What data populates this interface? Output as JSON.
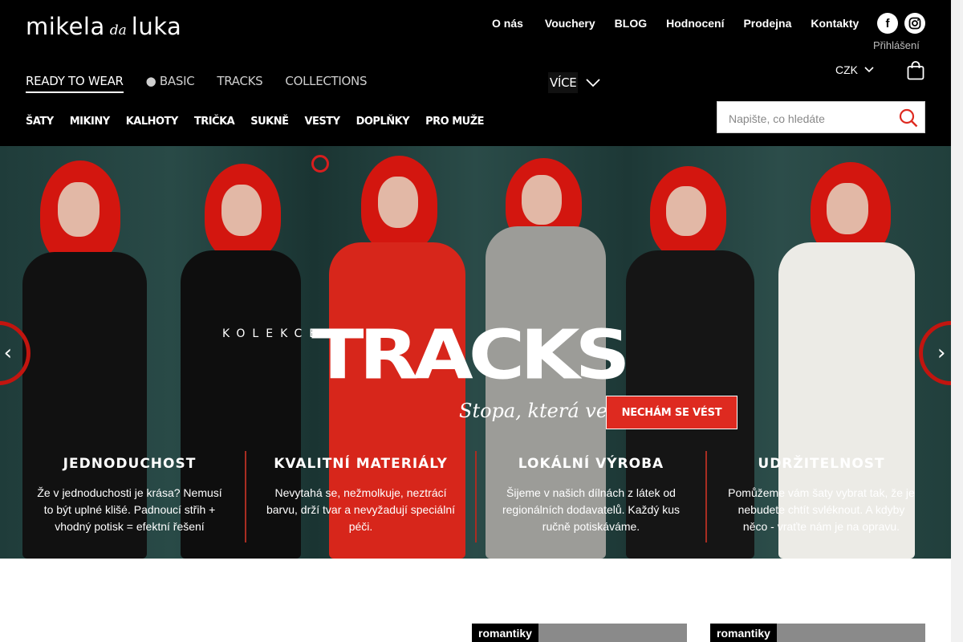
{
  "brand": {
    "name_a": "mikela",
    "name_b": "da",
    "name_c": "luka"
  },
  "topnav": [
    {
      "label": "O nás"
    },
    {
      "label": "Vouchery",
      "icon": ""
    },
    {
      "label": "BLOG"
    },
    {
      "label": "Hodnocení"
    },
    {
      "label": "Prodejna"
    },
    {
      "label": "Kontakty"
    }
  ],
  "social": {
    "facebook": "f",
    "instagram": "instagram-icon"
  },
  "account": {
    "login": "Přihlášení"
  },
  "currency": {
    "value": "CZK"
  },
  "mainnav": [
    {
      "label": "READY TO WEAR"
    },
    {
      "label": "● BASIC"
    },
    {
      "label": " TRACKS"
    },
    {
      "label": "COLLECTIONS"
    }
  ],
  "more": {
    "label": "VÍCE"
  },
  "subnav": [
    {
      "label": "ŠATY"
    },
    {
      "label": "MIKINY"
    },
    {
      "label": "KALHOTY"
    },
    {
      "label": "TRIČKA"
    },
    {
      "label": "SUKNĚ"
    },
    {
      "label": "VESTY"
    },
    {
      "label": "DOPLŇKY"
    },
    {
      "label": "PRO MUŽE"
    }
  ],
  "search": {
    "placeholder": "Napište, co hledáte"
  },
  "hero": {
    "kolekce": "KOLEKCE",
    "title": "TRACKS",
    "tagline": "Stopa, která vede",
    "cta": "NECHÁM SE VÉST",
    "accent_color": "#de2a20"
  },
  "features": [
    {
      "title": "JEDNODUCHOST",
      "text": "Že v jednoduchosti je krása? Nemusí to být uplné klišé. Padnoucí střih + vhodný potisk = efektní řešení"
    },
    {
      "title": "KVALITNÍ MATERIÁLY",
      "text": "Nevytahá se, nežmolkuje, neztrácí barvu, drží tvar a nevyžadují speciální péči."
    },
    {
      "title": "LOKÁLNÍ VÝROBA",
      "text": "Šijeme v našich dílnách z látek od regionálních dodavatelů. Každý kus ručně potiskáváme."
    },
    {
      "title": "UDRŽITELNOST",
      "text": "Pomůžeme vám šaty vybrat tak, že je nebudete chtít svléknout. A kdyby něco - vraťte nám je na opravu."
    }
  ],
  "cards": [
    {
      "tag": "romantiky"
    },
    {
      "tag": "romantiky"
    }
  ]
}
